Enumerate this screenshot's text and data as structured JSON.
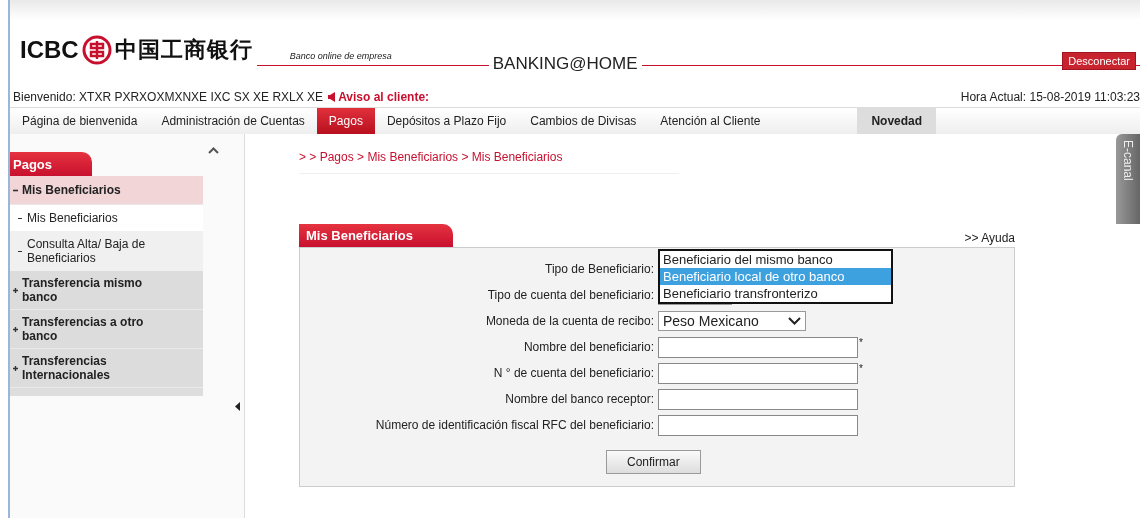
{
  "header": {
    "logo_latin": "ICBC",
    "logo_chinese": "中国工商银行",
    "tagline": "Banco online de empresa",
    "product": "BANKING@HOME",
    "logout": "Desconectar"
  },
  "welcome": "Bienvenido: XTXR PXRXOXMXNXE IXC SX XE RXLX XE",
  "notice": "Aviso al cliente:",
  "clock": "Hora Actual: 15-08-2019 11:03:23",
  "nav": [
    {
      "label": "Página de bienvenida",
      "selected": false
    },
    {
      "label": "Administración de Cuentas",
      "selected": false
    },
    {
      "label": "Pagos",
      "selected": true
    },
    {
      "label": "Depósitos a Plazo Fijo",
      "selected": false
    },
    {
      "label": "Cambios de Divisas",
      "selected": false
    },
    {
      "label": "Atención al Cliente",
      "selected": false
    }
  ],
  "novelty": "Novedad",
  "sidebar": {
    "title": "Pagos",
    "items": [
      {
        "label": "Mis Beneficiarios",
        "expanded": true,
        "children": [
          {
            "label": "Mis Beneficiarios",
            "selected": true
          },
          {
            "label": "Consulta Alta/ Baja de Beneficiarios",
            "selected": false
          }
        ]
      },
      {
        "label": "Transferencia mismo banco",
        "expanded": false
      },
      {
        "label": "Transferencias a otro banco",
        "expanded": false
      },
      {
        "label": "Transferencias Internacionales",
        "expanded": false
      }
    ]
  },
  "breadcrumb": "> > Pagos > Mis Beneficiarios > Mis Beneficiarios",
  "side_tab": "E-canal",
  "panel": {
    "title": "Mis Beneficiarios",
    "help": ">> Ayuda",
    "fields": [
      {
        "label": "Tipo de Beneficiario:",
        "kind": "select",
        "expanded": true,
        "options": [
          {
            "label": "Beneficiario del mismo banco",
            "selected": false
          },
          {
            "label": "Beneficiario local de otro banco",
            "selected": true
          },
          {
            "label": "Beneficiario transfronterizo",
            "selected": false
          }
        ]
      },
      {
        "label": "Tipo de cuenta del beneficiario:",
        "kind": "select"
      },
      {
        "label": "Moneda de la cuenta de recibo:",
        "kind": "select",
        "value": "Peso Mexicano"
      },
      {
        "label": "Nombre del beneficiario:",
        "kind": "text",
        "required_mark": "*"
      },
      {
        "label": "N ° de cuenta del beneficiario:",
        "kind": "text",
        "required_mark": "*"
      },
      {
        "label": "Nombre del banco receptor:",
        "kind": "text"
      },
      {
        "label": "Número de identificación fiscal RFC del beneficiario:",
        "kind": "text"
      }
    ],
    "button": "Confirmar"
  }
}
